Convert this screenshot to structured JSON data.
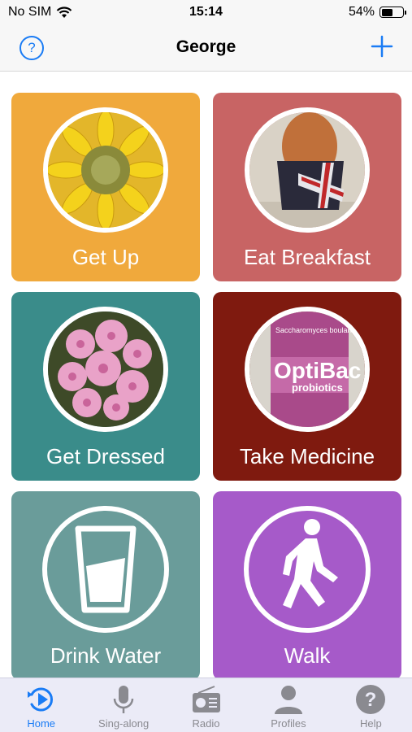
{
  "status_bar": {
    "carrier": "No SIM",
    "time": "15:14",
    "battery": "54%",
    "battery_level": 0.54
  },
  "nav": {
    "title": "George",
    "help_label": "?"
  },
  "tiles": [
    {
      "label": "Get Up",
      "color": "#f0a93c",
      "image": "sunflower"
    },
    {
      "label": "Eat Breakfast",
      "color": "#c86464",
      "image": "boiled-egg-in-cup"
    },
    {
      "label": "Get Dressed",
      "color": "#3a8c8a",
      "image": "pink-flowers"
    },
    {
      "label": "Take Medicine",
      "color": "#7f1a0f",
      "image": "probiotics-bottle",
      "image_text_1": "Saccharomyces boulardii",
      "image_text_2": "OptiBac",
      "image_text_3": "probiotics"
    },
    {
      "label": "Drink Water",
      "color": "#6a9c9a",
      "image": "glass-of-water-icon"
    },
    {
      "label": "Walk",
      "color": "#a65ac9",
      "image": "walking-person-icon"
    }
  ],
  "tab_bar": [
    {
      "label": "Home",
      "icon": "home-play-icon",
      "active": true
    },
    {
      "label": "Sing-along",
      "icon": "microphone-icon",
      "active": false
    },
    {
      "label": "Radio",
      "icon": "radio-icon",
      "active": false
    },
    {
      "label": "Profiles",
      "icon": "person-icon",
      "active": false
    },
    {
      "label": "Help",
      "icon": "help-icon",
      "active": false
    }
  ],
  "colors": {
    "accent": "#1a7cf5",
    "tab_inactive": "#8a8a90"
  }
}
